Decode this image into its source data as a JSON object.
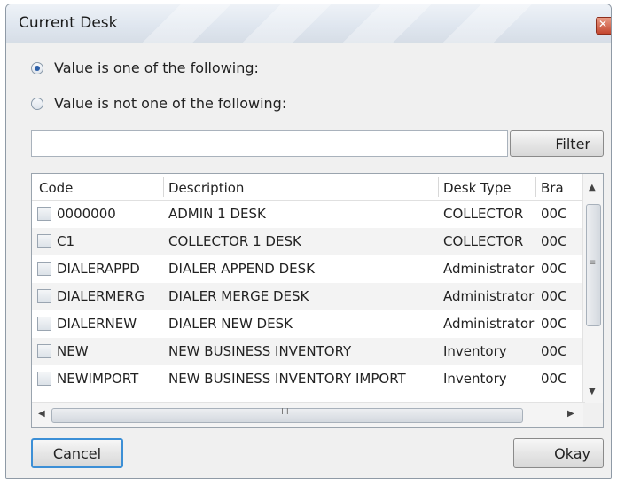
{
  "window": {
    "title": "Current Desk",
    "close_label": "x"
  },
  "options": {
    "is_one_of": "Value is one of the following:",
    "not_one_of": "Value is not one of the following:"
  },
  "filter": {
    "value": "",
    "button": "Filter"
  },
  "grid": {
    "columns": [
      "Code",
      "Description",
      "Desk Type",
      "Bra"
    ],
    "rows": [
      {
        "code": "0000000",
        "description": "ADMIN 1 DESK",
        "desk_type": "COLLECTOR",
        "branch": "00C"
      },
      {
        "code": "C1",
        "description": "COLLECTOR 1 DESK",
        "desk_type": "COLLECTOR",
        "branch": "00C"
      },
      {
        "code": "DIALERAPPD",
        "description": "DIALER APPEND DESK",
        "desk_type": "Administrator",
        "branch": "00C"
      },
      {
        "code": "DIALERMERG",
        "description": "DIALER MERGE DESK",
        "desk_type": "Administrator",
        "branch": "00C"
      },
      {
        "code": "DIALERNEW",
        "description": "DIALER NEW DESK",
        "desk_type": "Administrator",
        "branch": "00C"
      },
      {
        "code": "NEW",
        "description": "NEW BUSINESS INVENTORY",
        "desk_type": "Inventory",
        "branch": "00C"
      },
      {
        "code": "NEWIMPORT",
        "description": "NEW BUSINESS INVENTORY IMPORT",
        "desk_type": "Inventory",
        "branch": "00C"
      }
    ]
  },
  "buttons": {
    "cancel": "Cancel",
    "okay": "Okay"
  },
  "scroll": {
    "grip": "≡",
    "hgrip": "III"
  }
}
